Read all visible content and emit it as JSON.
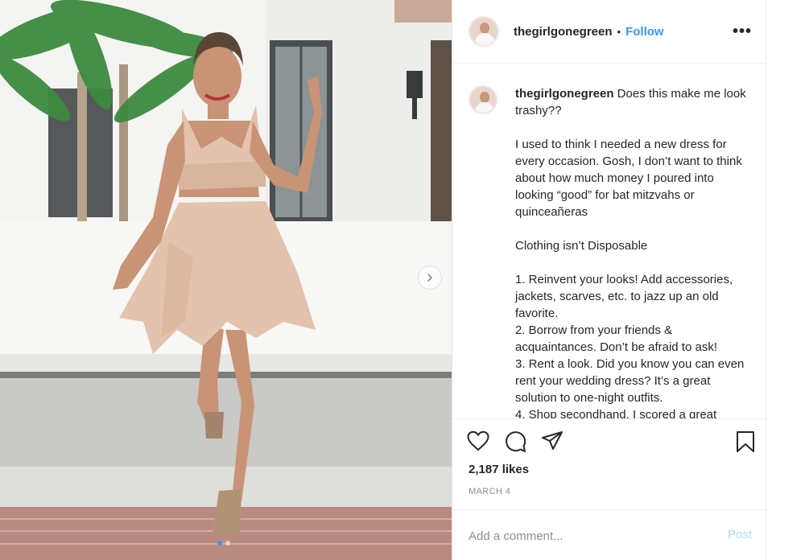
{
  "post": {
    "username": "thegirlgonegreen",
    "separator": "•",
    "follow_label": "Follow",
    "more_label": "•••",
    "caption_user": "thegirlgonegreen",
    "caption_body": " Does this make me look trashy??\n\nI used to think I needed a new dress for every occasion. Gosh, I don’t want to think about how much money I poured into looking “good” for bat mitzvahs or quinceañeras\n\nClothing isn’t Disposable\n\n1. Reinvent your looks! Add accessories, jackets, scarves, etc. to jazz up an old favorite.\n2. Borrow from your friends & acquaintances. Don’t be afraid to ask!\n3. Rent a look. Did you know you can even rent your wedding dress? It’s a great solution to one-night outfits.\n4. Shop secondhand. I scored a great",
    "likes": "2,187 likes",
    "date": "MARCH 4",
    "comment_placeholder": "Add a comment...",
    "post_label": "Post"
  },
  "icons": {
    "like": "heart-icon",
    "comment": "comment-icon",
    "share": "share-icon",
    "save": "bookmark-icon",
    "next": "chevron-right-icon"
  },
  "colors": {
    "accent": "#3897f0",
    "post_disabled": "#b3dbff",
    "text": "#262626",
    "muted": "#8e8e8e",
    "dress": "#e3c3ad"
  }
}
